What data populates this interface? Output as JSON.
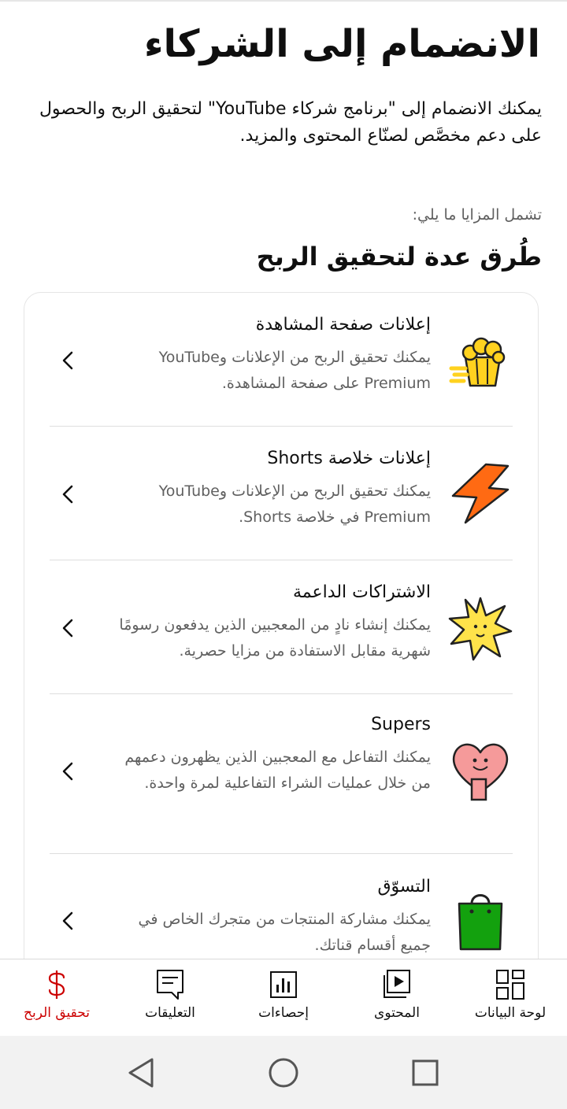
{
  "page": {
    "title": "الانضمام إلى الشركاء",
    "intro": "يمكنك الانضمام إلى \"برنامج شركاء YouTube\" لتحقيق الربح والحصول على دعم مخصَّص لصنّاع المحتوى والمزيد.",
    "benefits_label": "تشمل المزايا ما يلي:",
    "section_title": "طُرق عدة لتحقيق الربح"
  },
  "items": [
    {
      "title": "إعلانات صفحة المشاهدة",
      "desc": "يمكنك تحقيق الربح من الإعلانات وYouTube Premium على صفحة المشاهدة.",
      "icon": "popcorn-icon"
    },
    {
      "title": "إعلانات خلاصة Shorts",
      "desc": "يمكنك تحقيق الربح من الإعلانات وYouTube Premium في خلاصة Shorts.",
      "icon": "lightning-icon"
    },
    {
      "title": "الاشتراكات الداعمة",
      "desc": "يمكنك إنشاء نادٍ من المعجبين الذين يدفعون رسومًا شهرية مقابل الاستفادة من مزايا حصرية.",
      "icon": "star-burst-icon"
    },
    {
      "title": "Supers",
      "desc": "يمكنك التفاعل مع المعجبين الذين يظهرون دعمهم من خلال عمليات الشراء التفاعلية لمرة واحدة.",
      "icon": "heart-character-icon"
    },
    {
      "title": "التسوّق",
      "desc": "يمكنك مشاركة المنتجات من متجرك الخاص في جميع أقسام قناتك.",
      "icon": "shopping-bag-icon"
    }
  ],
  "nav": {
    "dashboard": "لوحة البيانات",
    "content": "المحتوى",
    "analytics": "إحصاءات",
    "comments": "التعليقات",
    "earn": "تحقيق الربح"
  },
  "colors": {
    "accent": "#cc0000",
    "popcorn": "#ffd21f",
    "lightning": "#ff6a13",
    "star": "#ffe34a",
    "heart": "#f59a9a",
    "bag": "#13a10e"
  }
}
